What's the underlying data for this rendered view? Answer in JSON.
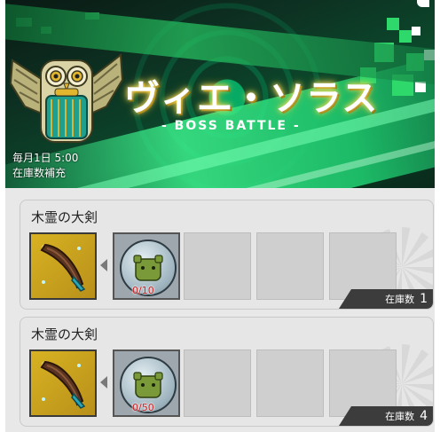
{
  "banner": {
    "title": "ヴィエ・ソラス",
    "subtitle": "- BOSS BATTLE -",
    "restock_schedule": "毎月1日 5:00",
    "restock_label": "在庫数補充"
  },
  "items": [
    {
      "name": "木霊の大剣",
      "material_count": "0/10",
      "stock_label": "在庫数",
      "stock_value": "1",
      "reward_icon": "feather-sword-icon",
      "material_icon": "frog-plate-icon"
    },
    {
      "name": "木霊の大剣",
      "material_count": "0/50",
      "stock_label": "在庫数",
      "stock_value": "4",
      "reward_icon": "feather-sword-icon",
      "material_icon": "frog-plate-icon"
    }
  ],
  "colors": {
    "banner_green": "#2fd86b",
    "title_glow": "#f2c230",
    "reward_bg": "#d8b222",
    "count_red": "#cc2222",
    "stock_bg": "#3c3c3c"
  }
}
